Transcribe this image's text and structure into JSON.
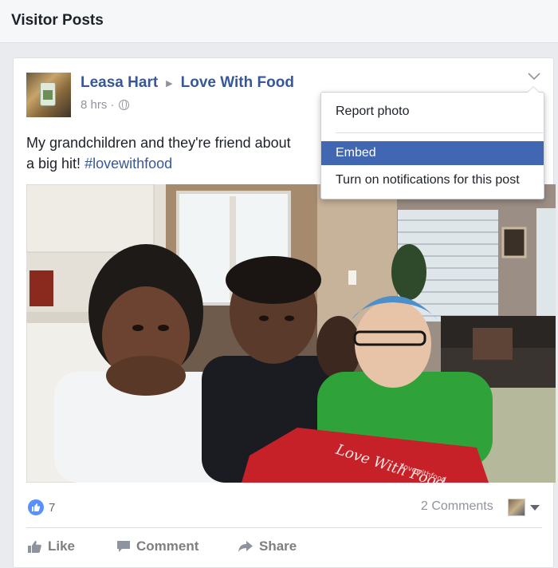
{
  "page": {
    "title": "Visitor Posts"
  },
  "post": {
    "author": "Leasa Hart",
    "target": "Love With Food",
    "time": "8 hrs",
    "time_separator": "·",
    "text": "My grandchildren and they're friend about",
    "text_line2": "a big hit!",
    "hashtag": "#lovewithfood",
    "photo_box_text": "Love With Food",
    "photo_box_subtext": "lovewithfood"
  },
  "menu": {
    "items": [
      {
        "label": "Report photo"
      },
      {
        "label": "Embed"
      },
      {
        "label": "Turn on notifications for this post"
      }
    ]
  },
  "stats": {
    "likes": "7",
    "comments": "2 Comments"
  },
  "actions": {
    "like": "Like",
    "comment": "Comment",
    "share": "Share"
  },
  "colors": {
    "link": "#365899",
    "menu_active": "#4267b2",
    "like_badge": "#5890ff"
  }
}
